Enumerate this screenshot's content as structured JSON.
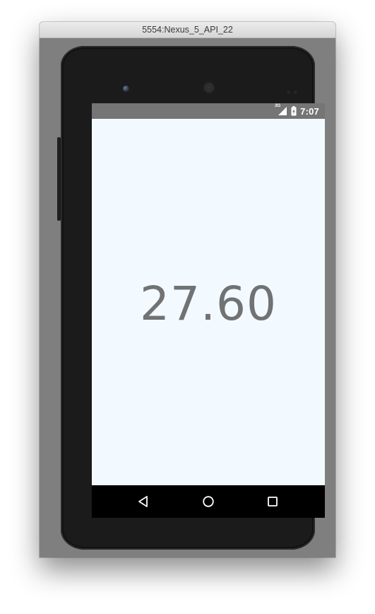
{
  "window": {
    "title": "5554:Nexus_5_API_22"
  },
  "status_bar": {
    "network_type": "3G",
    "time": "7:07",
    "icons": [
      "signal-icon",
      "battery-charging-icon"
    ]
  },
  "main": {
    "value": "27.60"
  },
  "nav_bar": {
    "buttons": [
      "back-icon",
      "home-icon",
      "recent-apps-icon"
    ]
  },
  "colors": {
    "app_background": "#f3faff",
    "status_bar": "#757575",
    "value_text": "#707273",
    "nav_bar": "#000000",
    "emulator_frame": "#7f7f7f",
    "device_body": "#1b1b1b"
  }
}
